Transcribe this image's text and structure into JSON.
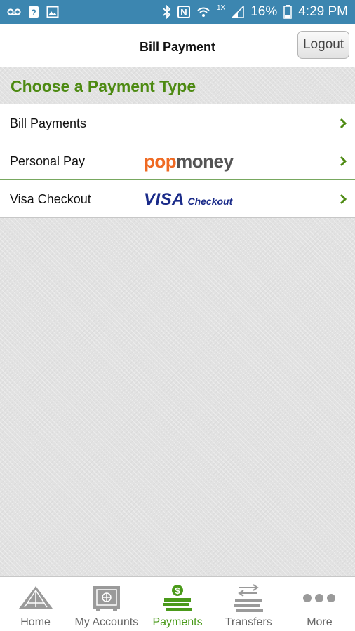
{
  "status_bar": {
    "battery": "16%",
    "time": "4:29 PM",
    "network": "1X"
  },
  "header": {
    "title": "Bill Payment",
    "logout_label": "Logout"
  },
  "section": {
    "title": "Choose a Payment Type"
  },
  "payment_types": [
    {
      "label": "Bill Payments"
    },
    {
      "label": "Personal Pay",
      "logo": {
        "part1": "pop",
        "part2": "money"
      }
    },
    {
      "label": "Visa Checkout",
      "logo": {
        "part1": "VISA",
        "part2": "Checkout"
      }
    }
  ],
  "tabs": [
    {
      "label": "Home",
      "icon": "home-icon",
      "active": false
    },
    {
      "label": "My Accounts",
      "icon": "accounts-icon",
      "active": false
    },
    {
      "label": "Payments",
      "icon": "payments-icon",
      "active": true
    },
    {
      "label": "Transfers",
      "icon": "transfers-icon",
      "active": false
    },
    {
      "label": "More",
      "icon": "more-icon",
      "active": false
    }
  ],
  "colors": {
    "status_bar": "#3c86b0",
    "accent_green": "#4d8a12",
    "active_tab": "#4a9a1a",
    "popmoney_orange": "#ef6a23",
    "visa_blue": "#1a2b89"
  }
}
